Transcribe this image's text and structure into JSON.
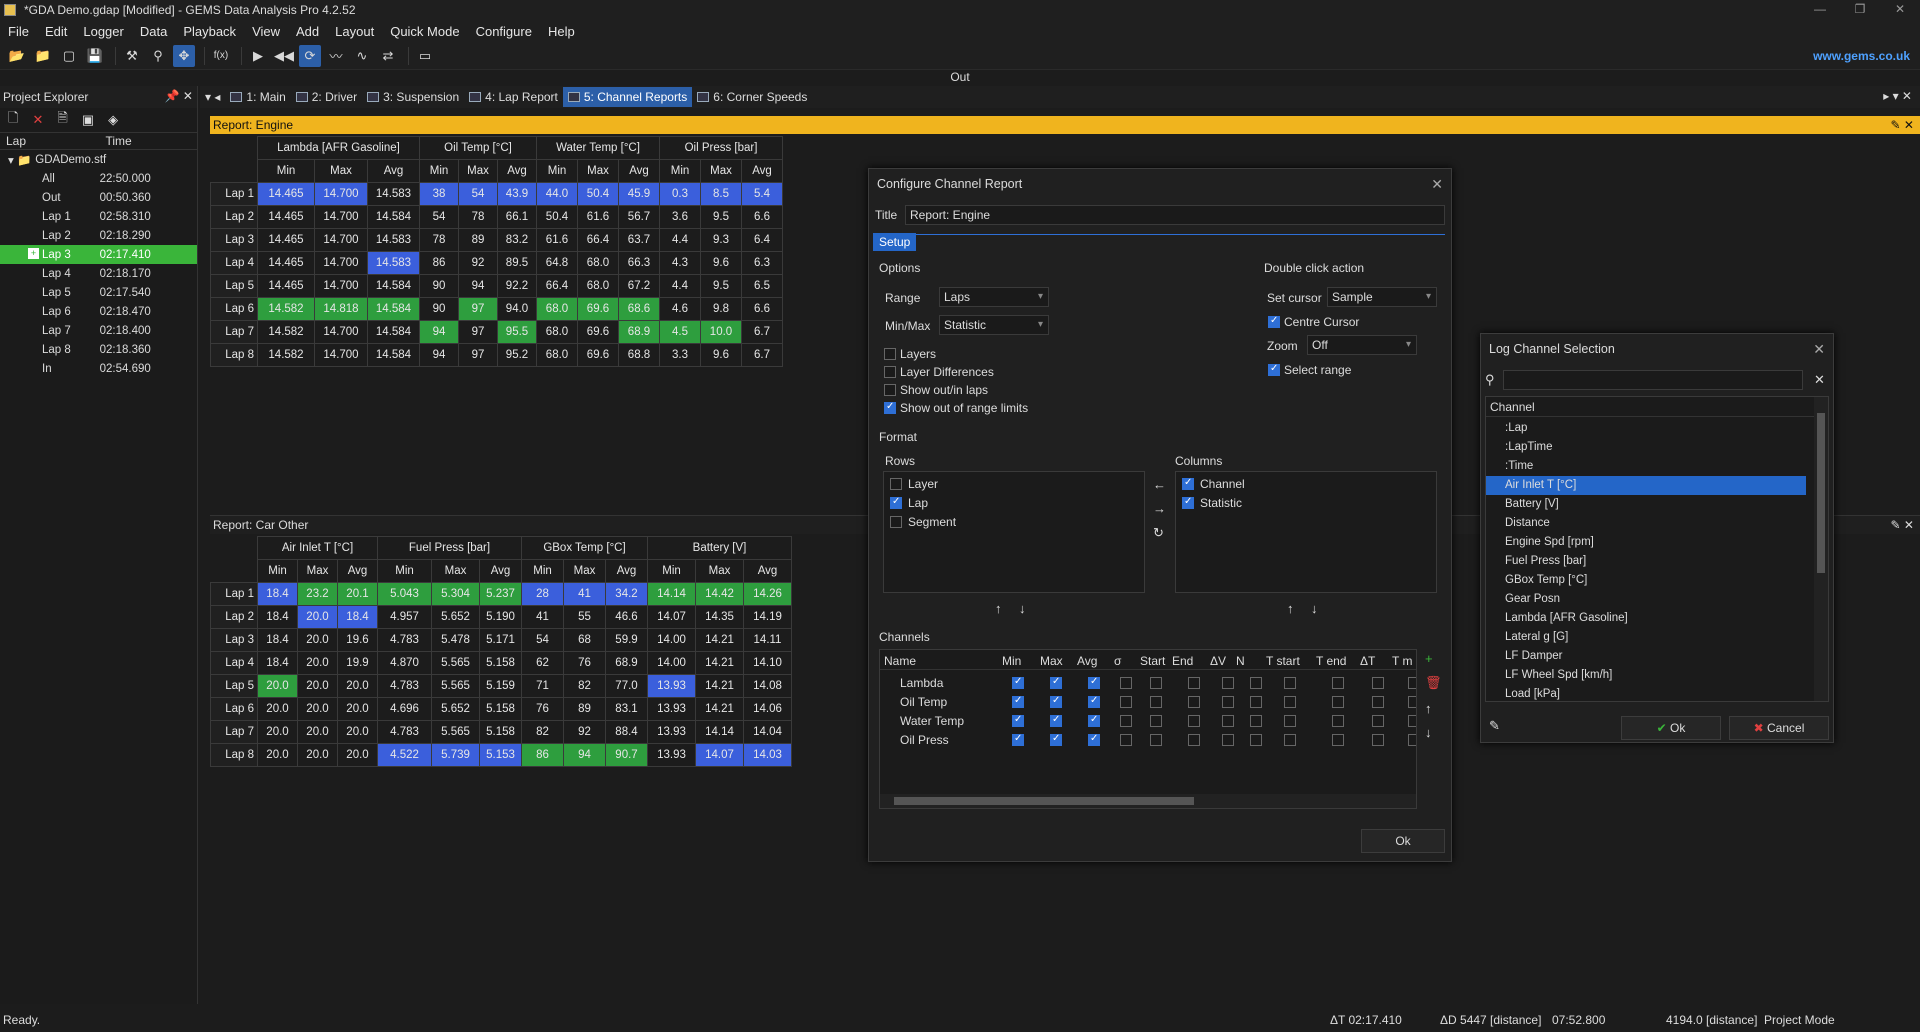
{
  "window": {
    "title": "*GDA Demo.gdap [Modified] - GEMS Data Analysis Pro 4.2.52",
    "url": "www.gems.co.uk"
  },
  "menu": [
    "File",
    "Edit",
    "Logger",
    "Data",
    "Playback",
    "View",
    "Add",
    "Layout",
    "Quick Mode",
    "Configure",
    "Help"
  ],
  "toolbar": {
    "fx_label": "f(x)"
  },
  "out_label": "Out",
  "explorer": {
    "title": "Project Explorer",
    "col_lap": "Lap",
    "col_time": "Time",
    "root": "GDADemo.stf",
    "rows": [
      {
        "lap": "All",
        "time": "22:50.000"
      },
      {
        "lap": "Out",
        "time": "00:50.360"
      },
      {
        "lap": "Lap 1",
        "time": "02:58.310"
      },
      {
        "lap": "Lap 2",
        "time": "02:18.290"
      },
      {
        "lap": "Lap 3",
        "time": "02:17.410"
      },
      {
        "lap": "Lap 4",
        "time": "02:18.170"
      },
      {
        "lap": "Lap 5",
        "time": "02:17.540"
      },
      {
        "lap": "Lap 6",
        "time": "02:18.470"
      },
      {
        "lap": "Lap 7",
        "time": "02:18.400"
      },
      {
        "lap": "Lap 8",
        "time": "02:18.360"
      },
      {
        "lap": "In",
        "time": "02:54.690"
      }
    ]
  },
  "tabs": [
    "1: Main",
    "2: Driver",
    "3: Suspension",
    "4: Lap Report",
    "5: Channel Reports",
    "6: Corner Speeds"
  ],
  "report_engine": {
    "title": "Report: Engine",
    "groups": [
      "Lambda [AFR Gasoline]",
      "Oil Temp [°C]",
      "Water Temp [°C]",
      "Oil Press [bar]"
    ],
    "stats": [
      "Min",
      "Max",
      "Avg"
    ],
    "rows": [
      {
        "label": "Lap 1",
        "v": [
          "14.465",
          "14.700",
          "14.583",
          "38",
          "54",
          "43.9",
          "44.0",
          "50.4",
          "45.9",
          "0.3",
          "8.5",
          "5.4"
        ],
        "c": "bbnbbbbbbbbb"
      },
      {
        "label": "Lap 2",
        "v": [
          "14.465",
          "14.700",
          "14.584",
          "54",
          "78",
          "66.1",
          "50.4",
          "61.6",
          "56.7",
          "3.6",
          "9.5",
          "6.6"
        ],
        "c": "nnnnnnnnnnnn"
      },
      {
        "label": "Lap 3",
        "v": [
          "14.465",
          "14.700",
          "14.583",
          "78",
          "89",
          "83.2",
          "61.6",
          "66.4",
          "63.7",
          "4.4",
          "9.3",
          "6.4"
        ],
        "c": "nnnnnnnnnnnn"
      },
      {
        "label": "Lap 4",
        "v": [
          "14.465",
          "14.700",
          "14.583",
          "86",
          "92",
          "89.5",
          "64.8",
          "68.0",
          "66.3",
          "4.3",
          "9.6",
          "6.3"
        ],
        "c": "nnbnnnnnnnnn"
      },
      {
        "label": "Lap 5",
        "v": [
          "14.465",
          "14.700",
          "14.584",
          "90",
          "94",
          "92.2",
          "66.4",
          "68.0",
          "67.2",
          "4.4",
          "9.5",
          "6.5"
        ],
        "c": "nnnnnnnnnnnn"
      },
      {
        "label": "Lap 6",
        "v": [
          "14.582",
          "14.818",
          "14.584",
          "90",
          "97",
          "94.0",
          "68.0",
          "69.6",
          "68.6",
          "4.6",
          "9.8",
          "6.6"
        ],
        "c": "gggngngggnnn"
      },
      {
        "label": "Lap 7",
        "v": [
          "14.582",
          "14.700",
          "14.584",
          "94",
          "97",
          "95.5",
          "68.0",
          "69.6",
          "68.9",
          "4.5",
          "10.0",
          "6.7"
        ],
        "c": "nnngngnnggg"
      },
      {
        "label": "Lap 8",
        "v": [
          "14.582",
          "14.700",
          "14.584",
          "94",
          "97",
          "95.2",
          "68.0",
          "69.6",
          "68.8",
          "3.3",
          "9.6",
          "6.7"
        ],
        "c": "nnnnnnnnnnnn"
      }
    ]
  },
  "report_car": {
    "title": "Report: Car Other",
    "groups": [
      "Air Inlet T [°C]",
      "Fuel Press [bar]",
      "GBox Temp [°C]",
      "Battery [V]"
    ],
    "stats": [
      "Min",
      "Max",
      "Avg"
    ],
    "rows": [
      {
        "label": "Lap 1",
        "v": [
          "18.4",
          "23.2",
          "20.1",
          "5.043",
          "5.304",
          "5.237",
          "28",
          "41",
          "34.2",
          "14.14",
          "14.42",
          "14.26"
        ],
        "c": "bgggggbbbggg"
      },
      {
        "label": "Lap 2",
        "v": [
          "18.4",
          "20.0",
          "18.4",
          "4.957",
          "5.652",
          "5.190",
          "41",
          "55",
          "46.6",
          "14.07",
          "14.35",
          "14.19"
        ],
        "c": "nbbnnnnnnnnn"
      },
      {
        "label": "Lap 3",
        "v": [
          "18.4",
          "20.0",
          "19.6",
          "4.783",
          "5.478",
          "5.171",
          "54",
          "68",
          "59.9",
          "14.00",
          "14.21",
          "14.11"
        ],
        "c": "nnnnnnnnnnnn"
      },
      {
        "label": "Lap 4",
        "v": [
          "18.4",
          "20.0",
          "19.9",
          "4.870",
          "5.565",
          "5.158",
          "62",
          "76",
          "68.9",
          "14.00",
          "14.21",
          "14.10"
        ],
        "c": "nnnnnnnnnnnn"
      },
      {
        "label": "Lap 5",
        "v": [
          "20.0",
          "20.0",
          "20.0",
          "4.783",
          "5.565",
          "5.159",
          "71",
          "82",
          "77.0",
          "13.93",
          "14.21",
          "14.08"
        ],
        "c": "gnnnnnnnnbnn"
      },
      {
        "label": "Lap 6",
        "v": [
          "20.0",
          "20.0",
          "20.0",
          "4.696",
          "5.652",
          "5.158",
          "76",
          "89",
          "83.1",
          "13.93",
          "14.21",
          "14.06"
        ],
        "c": "nnnnnnnnnnnn"
      },
      {
        "label": "Lap 7",
        "v": [
          "20.0",
          "20.0",
          "20.0",
          "4.783",
          "5.565",
          "5.158",
          "82",
          "92",
          "88.4",
          "13.93",
          "14.14",
          "14.04"
        ],
        "c": "nnnnnnnnnnnn"
      },
      {
        "label": "Lap 8",
        "v": [
          "20.0",
          "20.0",
          "20.0",
          "4.522",
          "5.739",
          "5.153",
          "86",
          "94",
          "90.7",
          "13.93",
          "14.07",
          "14.03"
        ],
        "c": "nnnbbbgggnbb"
      }
    ]
  },
  "configure_dialog": {
    "title": "Configure Channel Report",
    "title_label": "Title",
    "title_value": "Report: Engine",
    "tab": "Setup",
    "options_label": "Options",
    "range_label": "Range",
    "range_value": "Laps",
    "minmax_label": "Min/Max",
    "minmax_value": "Statistic",
    "checks": [
      {
        "label": "Layers",
        "on": false
      },
      {
        "label": "Layer Differences",
        "on": false
      },
      {
        "label": "Show out/in laps",
        "on": false
      },
      {
        "label": "Show out of range limits",
        "on": true
      }
    ],
    "dblclick_label": "Double click action",
    "setcursor_label": "Set cursor",
    "setcursor_value": "Sample",
    "centre_cursor": "Centre Cursor",
    "zoom_label": "Zoom",
    "zoom_value": "Off",
    "select_range": "Select range",
    "format_label": "Format",
    "rows_label": "Rows",
    "rows_items": [
      {
        "label": "Layer",
        "on": false
      },
      {
        "label": "Lap",
        "on": true
      },
      {
        "label": "Segment",
        "on": false
      }
    ],
    "columns_label": "Columns",
    "columns_items": [
      {
        "label": "Channel",
        "on": true
      },
      {
        "label": "Statistic",
        "on": true
      }
    ],
    "channels_label": "Channels",
    "channel_cols": [
      "Name",
      "Min",
      "Max",
      "Avg",
      "σ",
      "Start",
      "End",
      "ΔV",
      "N",
      "T start",
      "T end",
      "ΔT",
      "T m"
    ],
    "channels": [
      "Lambda",
      "Oil Temp",
      "Water Temp",
      "Oil Press"
    ],
    "ok": "Ok"
  },
  "log_channel_dialog": {
    "title": "Log Channel Selection",
    "search_placeholder": "",
    "col": "Channel",
    "items": [
      ":Lap",
      ":LapTime",
      ":Time",
      "Air Inlet T [°C]",
      "Battery [V]",
      "Distance",
      "Engine Spd [rpm]",
      "Fuel Press [bar]",
      "GBox Temp [°C]",
      "Gear Posn",
      "Lambda [AFR Gasoline]",
      "Lateral g [G]",
      "LF Damper",
      "LF Wheel Spd [km/h]",
      "Load [kPa]"
    ],
    "selected": "Air Inlet T [°C]",
    "ok": "Ok",
    "cancel": "Cancel"
  },
  "status": {
    "left": "Ready.",
    "dt": "ΔT 02:17.410",
    "dd": "ΔD 5447 [distance]",
    "time": "07:52.800",
    "dist": "4194.0 [distance]",
    "mode": "Project Mode"
  }
}
